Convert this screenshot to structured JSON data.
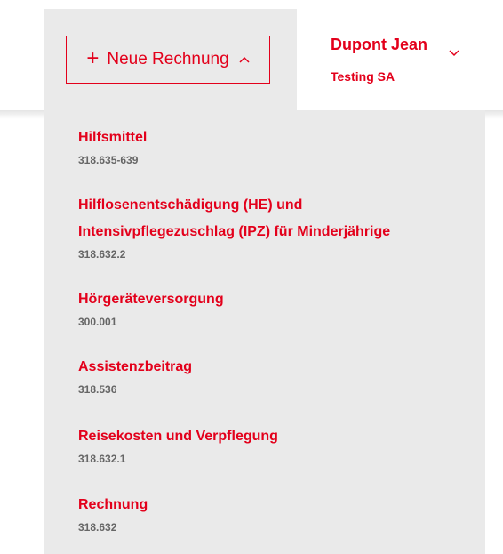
{
  "header": {
    "new_invoice": {
      "plus_glyph": "+",
      "label": "Neue Rechnung",
      "chevron_glyph": "^"
    },
    "user": {
      "name": "Dupont Jean",
      "company": "Testing SA"
    }
  },
  "dropdown": {
    "items": [
      {
        "title": "Hilfsmittel",
        "code": "318.635-639"
      },
      {
        "title_line1": "Hilflosenentschädigung (HE) und",
        "title_line2": "Intensivpflegezuschlag (IPZ) für Minderjährige",
        "code": "318.632.2"
      },
      {
        "title": "Hörgeräteversorgung",
        "code": "300.001"
      },
      {
        "title": "Assistenzbeitrag",
        "code": "318.536"
      },
      {
        "title": "Reisekosten und Verpflegung",
        "code": "318.632.1"
      },
      {
        "title": "Rechnung",
        "code": "318.632"
      }
    ]
  },
  "colors": {
    "accent": "#e3001b",
    "panel_bg": "#eaeaea",
    "code_text": "#666666"
  }
}
